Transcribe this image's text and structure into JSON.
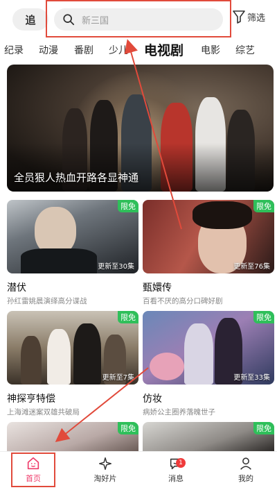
{
  "topbar": {
    "chase_label": "追",
    "search_placeholder": "新三国",
    "filter_label": "筛选"
  },
  "categories": [
    "纪录",
    "动漫",
    "番剧",
    "少儿",
    "电视剧",
    "电影",
    "综艺"
  ],
  "active_category": "电视剧",
  "hero": {
    "caption": "全员狠人热血开路各显神通"
  },
  "cards": [
    {
      "title": "潜伏",
      "desc": "孙红雷姚晨演绎高分谍战",
      "update": "更新至30集",
      "badge": "限免"
    },
    {
      "title": "甄嬛传",
      "desc": "百看不厌的高分口碑好剧",
      "update": "更新至76集",
      "badge": "限免"
    },
    {
      "title": "神探亨特偿",
      "desc": "上海滩迷案双雄共破局",
      "update": "更新至7集",
      "badge": "限免"
    },
    {
      "title": "仿妆",
      "desc": "病娇公主圈养落魄世子",
      "update": "更新至33集",
      "badge": "限免"
    },
    {
      "title": "",
      "desc": "",
      "update": "",
      "badge": "限免"
    },
    {
      "title": "",
      "desc": "",
      "update": "",
      "badge": "限免"
    }
  ],
  "bottomnav": {
    "items": [
      "首页",
      "淘好片",
      "消息",
      "我的"
    ],
    "message_count": "1"
  },
  "colors": {
    "accent": "#ef3b6a",
    "badge_green": "#2fbf5a",
    "annotation_red": "#e14a3b"
  }
}
